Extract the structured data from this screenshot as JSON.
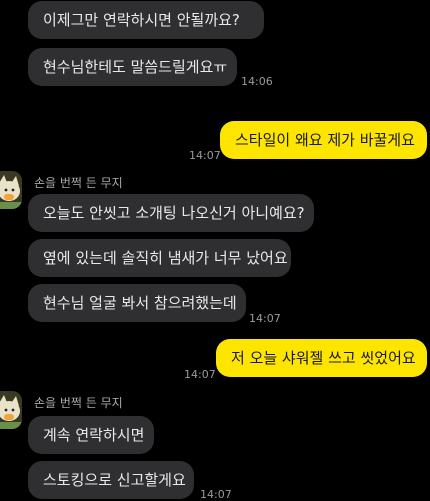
{
  "chat": {
    "messages": [
      {
        "id": "m1",
        "text": "이제그만 연락하시면 안될까요?",
        "time": ""
      },
      {
        "id": "m2",
        "text": "현수님한테도 말씀드릴게요ㅠ",
        "time": "14:06"
      },
      {
        "id": "m3",
        "text": "스타일이 왜요 제가 바꿀게요",
        "time": "14:07"
      },
      {
        "id": "m4",
        "text": "오늘도 안씻고 소개팅 나오신거 아니예요?",
        "time": ""
      },
      {
        "id": "m5",
        "text": "옆에 있는데 솔직히 냄새가 너무 났어요",
        "time": ""
      },
      {
        "id": "m6",
        "text": "현수님 얼굴 봐서 참으려했는데",
        "time": "14:07"
      },
      {
        "id": "m7",
        "text": "저 오늘 샤워젤 쓰고 씻었어요",
        "time": "14:07"
      },
      {
        "id": "m8",
        "text": "계속 연락하시면",
        "time": ""
      },
      {
        "id": "m9",
        "text": "스토킹으로 신고할게요",
        "time": "14:07"
      }
    ],
    "sender_name": "손을 번쩍 든 무지",
    "colors": {
      "background": "#000000",
      "incoming_bubble": "#2f2f31",
      "outgoing_bubble": "#fee500"
    },
    "avatar_icon": "muzi-character-icon"
  }
}
